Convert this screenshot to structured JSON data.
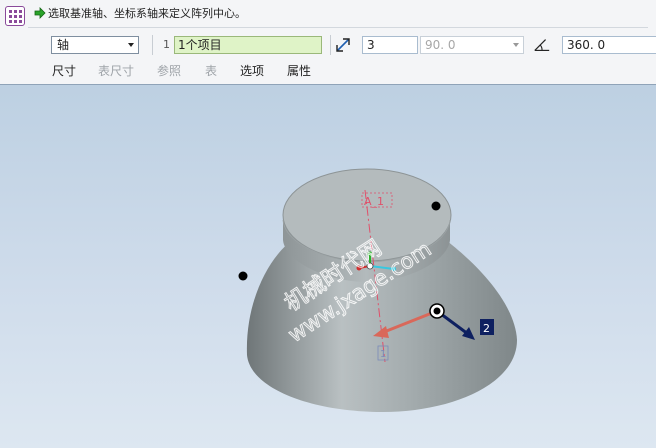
{
  "prompt": {
    "text": "选取基准轴、坐标系轴来定义阵列中心。"
  },
  "dashboard": {
    "pattern_type": "轴",
    "collector_index": "1",
    "collector_value": "1个项目",
    "member_count": "3",
    "angle_increment": "90. 0",
    "angular_extent": "360. 0"
  },
  "tabs": [
    {
      "label": "尺寸",
      "enabled": true
    },
    {
      "label": "表尺寸",
      "enabled": false
    },
    {
      "label": "参照",
      "enabled": false
    },
    {
      "label": "表",
      "enabled": false
    },
    {
      "label": "选项",
      "enabled": true
    },
    {
      "label": "属性",
      "enabled": true
    }
  ],
  "model": {
    "axis_label": "A_1",
    "direction_label_2": "2",
    "direction_label_1": "1",
    "watermark_line1": "机械时代网",
    "watermark_line2": "www.jxage.com"
  },
  "colors": {
    "accent_green": "#2aa32a",
    "collector_bg": "#dff3c7",
    "viewport_top": "#bdd0e2",
    "axis_red": "#e0506a",
    "arrow_red": "#d9685a",
    "arrow_navy": "#0e2060"
  }
}
